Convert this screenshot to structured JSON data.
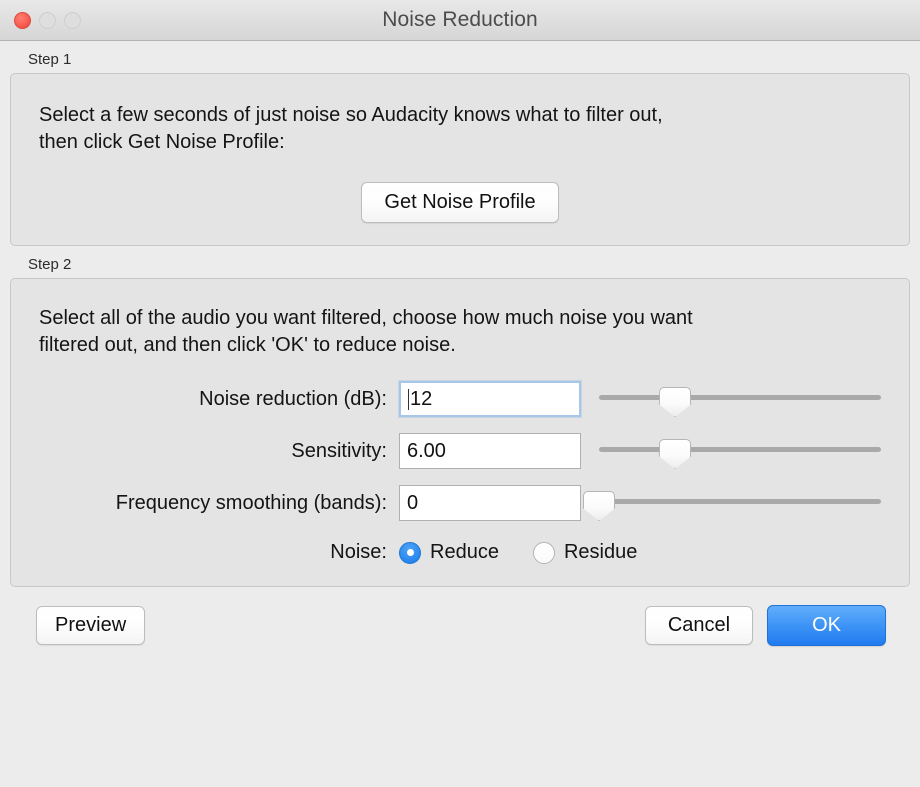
{
  "window": {
    "title": "Noise Reduction",
    "traffic_lights": [
      {
        "name": "close",
        "state": "active",
        "color": "#fa5e52"
      },
      {
        "name": "minimize",
        "state": "disabled",
        "color": "#dedede"
      },
      {
        "name": "zoom",
        "state": "disabled",
        "color": "#dedede"
      }
    ]
  },
  "step1": {
    "label": "Step 1",
    "instructions_line1": "Select a few seconds of just noise so Audacity knows what to filter out,",
    "instructions_line2": "then click Get Noise Profile:",
    "get_noise_profile_label": "Get Noise Profile"
  },
  "step2": {
    "label": "Step 2",
    "instructions_line1": "Select all of the audio you want filtered, choose how much noise you want",
    "instructions_line2": "filtered out, and then click 'OK' to reduce noise.",
    "controls": [
      {
        "label": "Noise reduction (dB):",
        "value": "12",
        "focused": true,
        "slider_percent": 27
      },
      {
        "label": "Sensitivity:",
        "value": "6.00",
        "focused": false,
        "slider_percent": 27
      },
      {
        "label": "Frequency smoothing (bands):",
        "value": "0",
        "focused": false,
        "slider_percent": 0
      }
    ],
    "noise": {
      "label": "Noise:",
      "options": [
        {
          "label": "Reduce",
          "selected": true
        },
        {
          "label": "Residue",
          "selected": false
        }
      ]
    }
  },
  "footer": {
    "preview_label": "Preview",
    "cancel_label": "Cancel",
    "ok_label": "OK",
    "ok_accent_color": "#2d8bf0"
  }
}
